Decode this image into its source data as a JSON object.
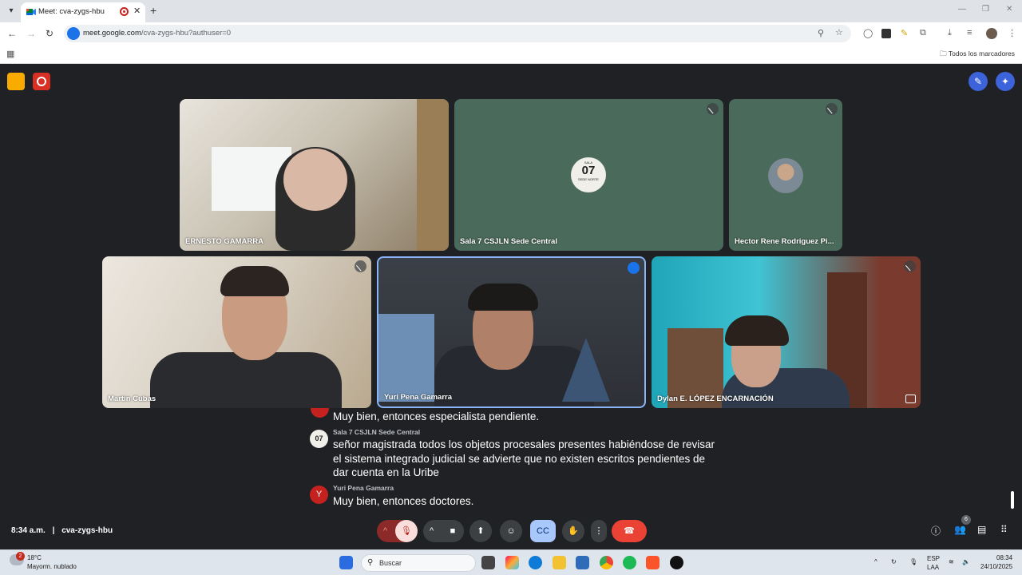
{
  "browser": {
    "tab_title": "Meet: cva-zygs-hbu",
    "url_host": "meet.google.com",
    "url_path": "/cva-zygs-hbu?authuser=0",
    "all_bookmarks": "Todos los marcadores"
  },
  "tiles": [
    {
      "name": "ERNESTO GAMARRA",
      "muted": false
    },
    {
      "name": "Sala 7 CSJLN Sede Central",
      "muted": true,
      "avatar_text": "07",
      "avatar_top": "SALA",
      "avatar_bottom": "SEDE NORTE"
    },
    {
      "name": "Hector Rene Rodriguez Pi...",
      "muted": true
    },
    {
      "name": "Martin Cubas",
      "muted": true
    },
    {
      "name": "Yuri Pena Gamarra",
      "speaking": true
    },
    {
      "name": "Dylan E. LÓPEZ ENCARNACIÓN",
      "muted": true
    }
  ],
  "captions": [
    {
      "speaker": "",
      "text": "Muy bien, entonces especialista pendiente."
    },
    {
      "speaker": "Sala 7 CSJLN Sede Central",
      "avatar": "07",
      "text": "señor magistrada todos los objetos procesales presentes habiéndose de revisar el sistema integrado judicial se advierte que no existen escritos pendientes de dar cuenta en la Uribe"
    },
    {
      "speaker": "Yuri Pena Gamarra",
      "avatar": "Y",
      "text": "Muy bien, entonces doctores."
    }
  ],
  "meeting": {
    "time": "8:34 a.m.",
    "code": "cva-zygs-hbu",
    "participants_count": "6"
  },
  "taskbar": {
    "weather_badge": "2",
    "temperature": "18°C",
    "condition": "Mayorm. nublado",
    "search": "Buscar",
    "lang_top": "ESP",
    "lang_bottom": "LAA",
    "clock_time": "08:34",
    "clock_date": "24/10/2025"
  },
  "colors": {
    "meet_bg": "#202124",
    "end_call": "#ea4335",
    "accent_blue": "#8ab4f8",
    "record_red": "#d93025",
    "activity_yellow": "#f9ab00"
  }
}
